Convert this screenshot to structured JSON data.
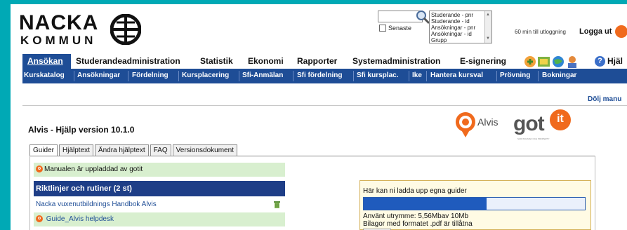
{
  "header": {
    "logo_top": "NACKA",
    "logo_bottom": "KOMMUN",
    "search": {
      "value": "",
      "senaste_label": "Senaste"
    },
    "search_types": [
      "Studerande - pnr",
      "Studerande - id",
      "Ansökningar - pnr",
      "Ansökningar - id",
      "Grupp"
    ],
    "logout_info": "60 min till utloggning",
    "logout_label": "Logga ut"
  },
  "main_menu": {
    "items": [
      "Ansökan",
      "Studerandeadministration",
      "Statistik",
      "Ekonomi",
      "Rapporter",
      "Systemadministration",
      "E-signering"
    ],
    "active": "Ansökan",
    "help_label": "Hjäl"
  },
  "sub_menu": {
    "items": [
      "Kurskatalog",
      "Ansökningar",
      "Fördelning",
      "Kursplacering",
      "Sfi-Anmälan",
      "Sfi fördelning",
      "Sfi kursplac.",
      "Ike",
      "Hantera kursval",
      "Prövning",
      "Bokningar"
    ]
  },
  "manual": {
    "hide_label": "Dölj manu",
    "title": "Alvis - Hjälp version 10.1.0",
    "alvis_label": "Alvis",
    "gotit_word": "got",
    "gotit_it": "it",
    "gotit_tagline": "SUR WOLMAN OCH PROPERTY",
    "tabs": [
      "Guider",
      "Hjälptext",
      "Ändra hjälptext",
      "FAQ",
      "Versionsdokument"
    ],
    "active_tab": "Guider",
    "notice": "Manualen är uppladdad av gotit",
    "section_heading": "Riktlinjer och rutiner (2 st)",
    "rows": [
      "Nacka vuxenutbildnings Handbok Alvis",
      "Guide_Alvis helpdesk"
    ]
  },
  "upload": {
    "title": "Här kan ni ladda upp egna guider",
    "usage_fraction": 0.556,
    "usage_text": "Använt utrymme: 5,56Mbav 10Mb",
    "format_note": "Bilagor med formatet .pdf är tillåtna"
  },
  "colors": {
    "brand_blue": "#1e4d96",
    "accent_orange": "#f06a1d",
    "frame_teal": "#00a9b5"
  }
}
